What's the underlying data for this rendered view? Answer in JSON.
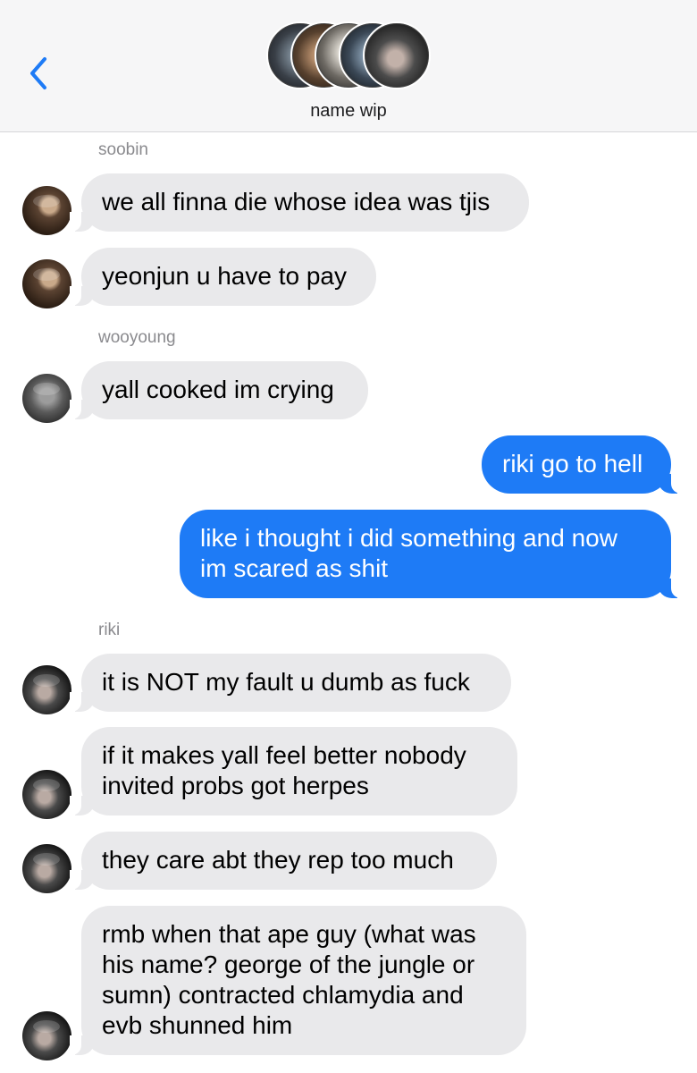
{
  "header": {
    "title": "name wip",
    "avatar_count": 5
  },
  "colors": {
    "outgoing_bubble": "#1e7bf6",
    "incoming_bubble": "#e9e9eb",
    "accent": "#1e7bf6"
  },
  "icons": {
    "back": "chevron-left-icon"
  },
  "messages": {
    "soobin_name": "soobin",
    "m1": "we all finna die whose idea was tjis",
    "m2": "yeonjun u have to pay",
    "wooyoung_name": "wooyoung",
    "m3": "yall cooked im crying",
    "m4": "riki go to hell",
    "m5_line1": "like i thought i did something and now",
    "m5_line2": "im scared as shit",
    "riki_name": "riki",
    "m6": "it is NOT my fault u dumb as fuck",
    "m7_line1": "if it makes yall feel better nobody",
    "m7_line2": "invited probs got herpes",
    "m8": "they care abt they rep too much",
    "m9_line1": "rmb when that ape guy (what was",
    "m9_line2": "his name? george of the jungle or",
    "m9_line3": "sumn) contracted chlamydia and",
    "m9_line4": "evb shunned him"
  }
}
